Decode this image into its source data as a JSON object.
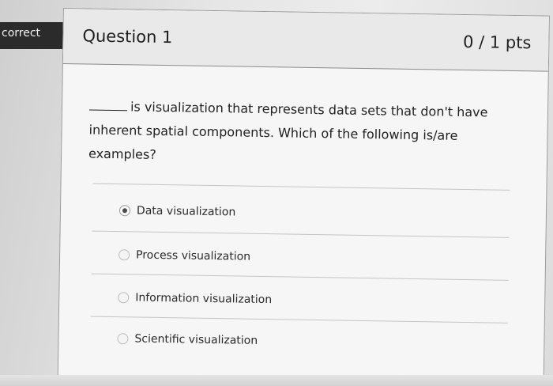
{
  "status_tab": {
    "label": "correct"
  },
  "question": {
    "title": "Question 1",
    "points": "0 / 1 pts",
    "text": "is visualization that represents data sets that don't have inherent spatial components. Which of the following is/are examples?"
  },
  "answers": [
    {
      "label": "Data visualization",
      "selected": true
    },
    {
      "label": "Process visualization",
      "selected": false
    },
    {
      "label": "Information visualization",
      "selected": false
    },
    {
      "label": "Scientific visualization",
      "selected": false
    }
  ]
}
